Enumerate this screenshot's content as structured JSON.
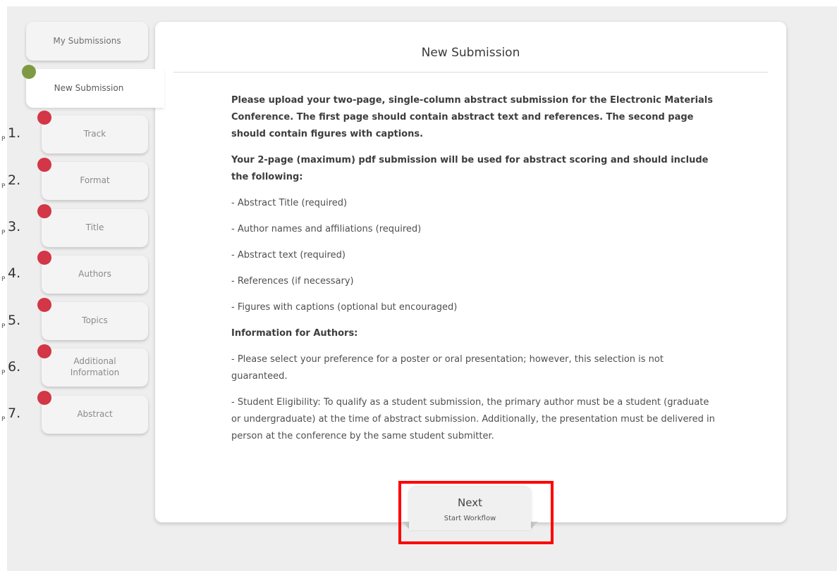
{
  "sidebar": {
    "my_submissions": "My Submissions",
    "new_submission": "New Submission",
    "step_prefix": "P",
    "steps": [
      {
        "num": "1.",
        "label": "Track"
      },
      {
        "num": "2.",
        "label": "Format"
      },
      {
        "num": "3.",
        "label": "Title"
      },
      {
        "num": "4.",
        "label": "Authors"
      },
      {
        "num": "5.",
        "label": "Topics"
      },
      {
        "num": "6.",
        "label": "Additional Information"
      },
      {
        "num": "7.",
        "label": "Abstract"
      }
    ]
  },
  "main": {
    "title": "New Submission",
    "intro": "Please upload your two-page, single-column abstract submission for the Electronic Materials Conference. The first page should contain abstract text and references. The second page should contain figures with captions.",
    "scoring_heading": "Your 2-page (maximum) pdf submission will be used for abstract scoring and should include the following:",
    "items": [
      "- Abstract Title (required)",
      "- Author names and affiliations (required)",
      "- Abstract text (required)",
      "- References (if necessary)",
      "- Figures with captions (optional but encouraged)"
    ],
    "info_heading": "Information for Authors:",
    "info_items": [
      "- Please select your preference for a poster or oral presentation; however, this selection is not guaranteed.",
      "- Student Eligibility: To qualify as a student submission, the primary author must be a student (graduate or undergraduate) at the time of abstract submission. Additionally, the presentation must be delivered in person at the conference by the same student submitter."
    ]
  },
  "next_button": {
    "label": "Next",
    "sublabel": "Start Workflow"
  },
  "colors": {
    "completed_dot": "#7f9a43",
    "pending_dot": "#d23647",
    "highlight": "#ff0000"
  }
}
